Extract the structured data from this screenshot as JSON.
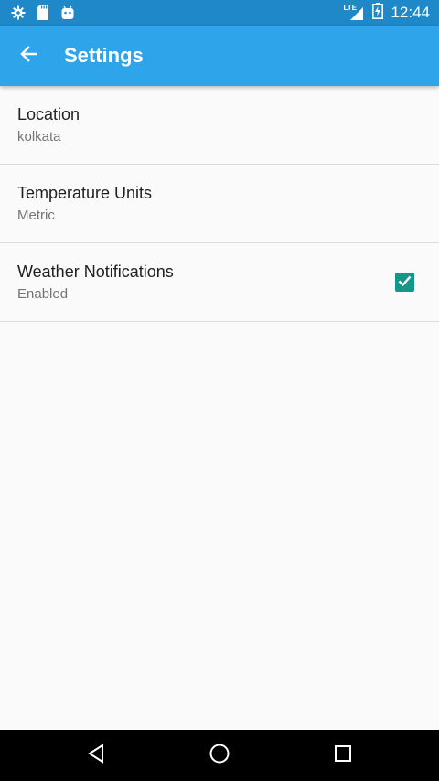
{
  "status_bar": {
    "time": "12:44",
    "network": "LTE",
    "left_icons": [
      "gear-icon",
      "sd-card-icon",
      "android-icon"
    ],
    "background": "#1e88c8"
  },
  "app_bar": {
    "title": "Settings",
    "back_icon": "arrow-back-icon",
    "background": "#2ea4eb"
  },
  "settings": [
    {
      "title": "Location",
      "summary": "kolkata"
    },
    {
      "title": "Temperature Units",
      "summary": "Metric"
    },
    {
      "title": "Weather Notifications",
      "summary": "Enabled",
      "checked": true
    }
  ],
  "accent": "#159688",
  "nav_bar": {
    "icons": [
      "back-triangle-icon",
      "home-circle-icon",
      "recents-square-icon"
    ]
  }
}
